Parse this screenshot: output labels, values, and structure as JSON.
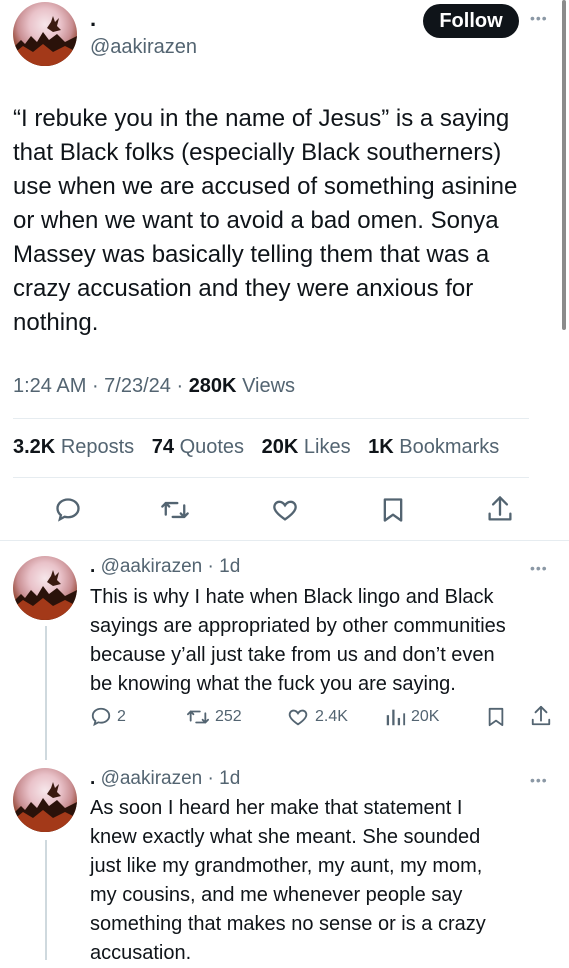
{
  "main_tweet": {
    "display_name": ".",
    "handle": "@aakirazen",
    "follow_label": "Follow",
    "more_icon": "more-horizontal-icon",
    "text": "“I rebuke you in the name of Jesus” is a saying\nthat Black folks (especially Black southerners)\nuse when we are accused of something asinine\nor when we want to avoid a bad omen. Sonya\nMassey was basically telling them that was a\ncrazy accusation and they were anxious for\nnothing.",
    "time": "1:24 AM",
    "date": "7/23/24",
    "views_count": "280K",
    "views_label": "Views",
    "stats": {
      "reposts_count": "3.2K",
      "reposts_label": "Reposts",
      "quotes_count": "74",
      "quotes_label": "Quotes",
      "likes_count": "20K",
      "likes_label": "Likes",
      "bookmarks_count": "1K",
      "bookmarks_label": "Bookmarks"
    },
    "actions": [
      "reply-icon",
      "repost-icon",
      "like-icon",
      "bookmark-icon",
      "share-icon"
    ]
  },
  "replies": [
    {
      "display_name": ".",
      "handle": "@aakirazen",
      "age": "1d",
      "text": "This is why I hate when Black lingo and Black\nsayings are appropriated by other communities\nbecause y’all just take from us and don’t even\nbe knowing what the fuck you are saying.",
      "reply_count": "2",
      "repost_count": "252",
      "like_count": "2.4K",
      "view_count": "20K"
    },
    {
      "display_name": ".",
      "handle": "@aakirazen",
      "age": "1d",
      "text": "As soon I heard her make that statement I\nknew exactly what she meant. She sounded\njust like my grandmother, my aunt, my mom,\nmy cousins, and me whenever people say\nsomething that makes no sense or is a crazy\naccusation."
    }
  ],
  "colors": {
    "text": "#0f1419",
    "secondary": "#536471",
    "divider": "#e6ecf0",
    "follow_bg": "#0f1419"
  }
}
